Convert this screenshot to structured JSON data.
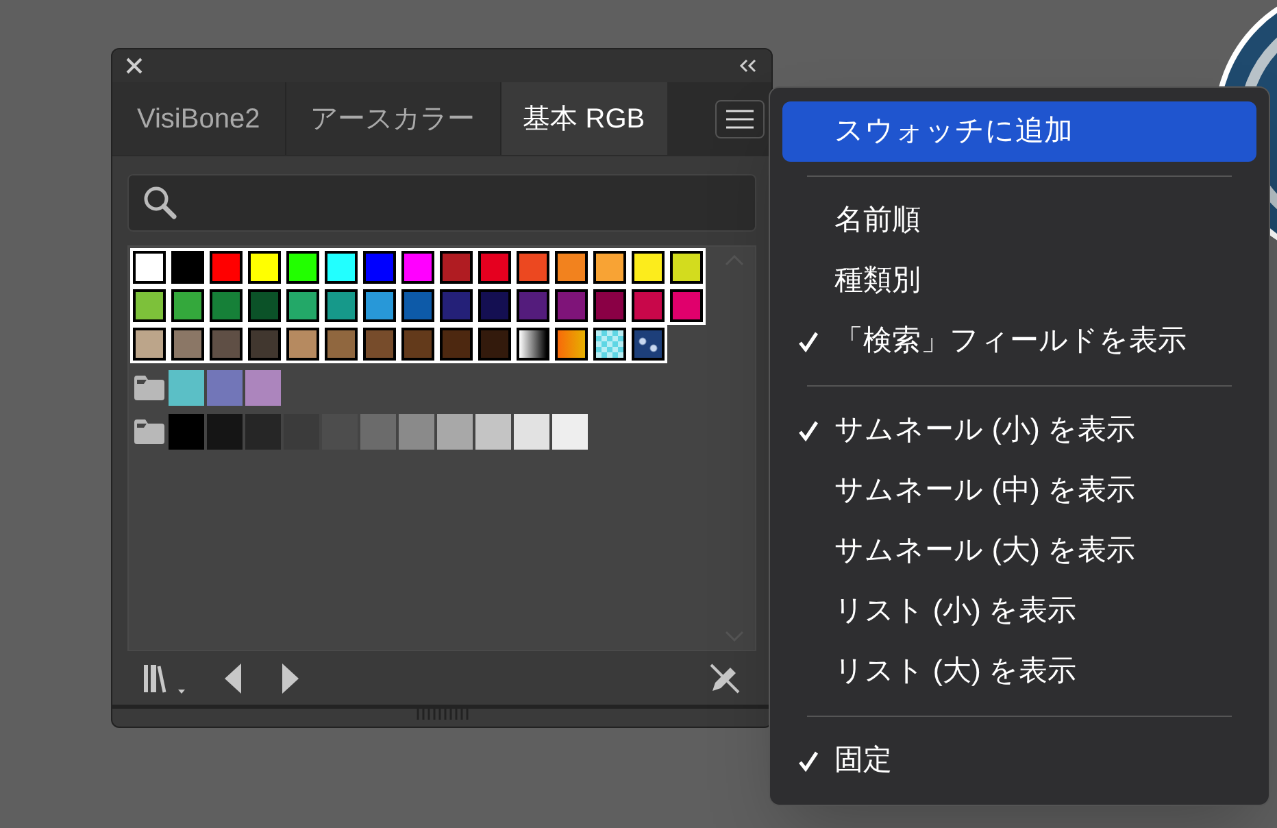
{
  "panel": {
    "tabs": [
      {
        "label": "VisiBone2",
        "selected": false
      },
      {
        "label": "アースカラー",
        "selected": false
      },
      {
        "label": "基本 RGB",
        "selected": true
      }
    ],
    "swatches": [
      {
        "kind": "solid",
        "color": "#ffffff"
      },
      {
        "kind": "solid",
        "color": "#000000"
      },
      {
        "kind": "solid",
        "color": "#ff0000"
      },
      {
        "kind": "solid",
        "color": "#ffff00"
      },
      {
        "kind": "solid",
        "color": "#22ff00"
      },
      {
        "kind": "solid",
        "color": "#22ffff"
      },
      {
        "kind": "solid",
        "color": "#0000ff"
      },
      {
        "kind": "solid",
        "color": "#ff00ff"
      },
      {
        "kind": "solid",
        "color": "#b01c22"
      },
      {
        "kind": "solid",
        "color": "#e5001f"
      },
      {
        "kind": "solid",
        "color": "#ec4820"
      },
      {
        "kind": "solid",
        "color": "#f2821e"
      },
      {
        "kind": "solid",
        "color": "#f8a334"
      },
      {
        "kind": "solid",
        "color": "#fcec1c"
      },
      {
        "kind": "solid",
        "color": "#d3dc1e"
      },
      {
        "kind": "solid",
        "color": "#7dc13a"
      },
      {
        "kind": "solid",
        "color": "#34a83c"
      },
      {
        "kind": "solid",
        "color": "#168038"
      },
      {
        "kind": "solid",
        "color": "#0b5228"
      },
      {
        "kind": "solid",
        "color": "#23a868"
      },
      {
        "kind": "solid",
        "color": "#16998a"
      },
      {
        "kind": "solid",
        "color": "#2898d8"
      },
      {
        "kind": "solid",
        "color": "#0d5aa8"
      },
      {
        "kind": "solid",
        "color": "#242078"
      },
      {
        "kind": "solid",
        "color": "#140f52"
      },
      {
        "kind": "solid",
        "color": "#541c7c"
      },
      {
        "kind": "solid",
        "color": "#7f1479"
      },
      {
        "kind": "solid",
        "color": "#8a0045"
      },
      {
        "kind": "solid",
        "color": "#c8074a"
      },
      {
        "kind": "solid",
        "color": "#e0006c"
      },
      {
        "kind": "solid",
        "color": "#bca58a"
      },
      {
        "kind": "solid",
        "color": "#8b7766"
      },
      {
        "kind": "solid",
        "color": "#5f4f45"
      },
      {
        "kind": "solid",
        "color": "#41372f"
      },
      {
        "kind": "solid",
        "color": "#b68a60"
      },
      {
        "kind": "solid",
        "color": "#90673f"
      },
      {
        "kind": "solid",
        "color": "#774c2b"
      },
      {
        "kind": "solid",
        "color": "#633a1b"
      },
      {
        "kind": "solid",
        "color": "#4d2810"
      },
      {
        "kind": "solid",
        "color": "#331a0c"
      },
      {
        "kind": "fade"
      },
      {
        "kind": "blend"
      },
      {
        "kind": "checker"
      },
      {
        "kind": "ornament"
      }
    ],
    "groups": [
      {
        "swatches": [
          {
            "color": "#5bbfc6"
          },
          {
            "color": "#7276b8"
          },
          {
            "color": "#ac85bd"
          }
        ]
      },
      {
        "swatches": [
          {
            "color": "#000000"
          },
          {
            "color": "#151515"
          },
          {
            "color": "#262626"
          },
          {
            "color": "#3b3b3b"
          },
          {
            "color": "#4d4d4d"
          },
          {
            "color": "#6b6b6b"
          },
          {
            "color": "#8a8a8a"
          },
          {
            "color": "#a8a8a8"
          },
          {
            "color": "#c4c4c4"
          },
          {
            "color": "#e2e2e2"
          },
          {
            "color": "#eeeeee"
          }
        ]
      }
    ]
  },
  "menu": {
    "sections": [
      [
        {
          "label": "スウォッチに追加",
          "checked": false,
          "selected": true
        }
      ],
      [
        {
          "label": "名前順",
          "checked": false,
          "selected": false
        },
        {
          "label": "種類別",
          "checked": false,
          "selected": false
        },
        {
          "label": "「検索」フィールドを表示",
          "checked": true,
          "selected": false
        }
      ],
      [
        {
          "label": "サムネール (小) を表示",
          "checked": true,
          "selected": false
        },
        {
          "label": "サムネール (中) を表示",
          "checked": false,
          "selected": false
        },
        {
          "label": "サムネール (大) を表示",
          "checked": false,
          "selected": false
        },
        {
          "label": "リスト (小) を表示",
          "checked": false,
          "selected": false
        },
        {
          "label": "リスト (大) を表示",
          "checked": false,
          "selected": false
        }
      ],
      [
        {
          "label": "固定",
          "checked": true,
          "selected": false
        }
      ]
    ]
  }
}
